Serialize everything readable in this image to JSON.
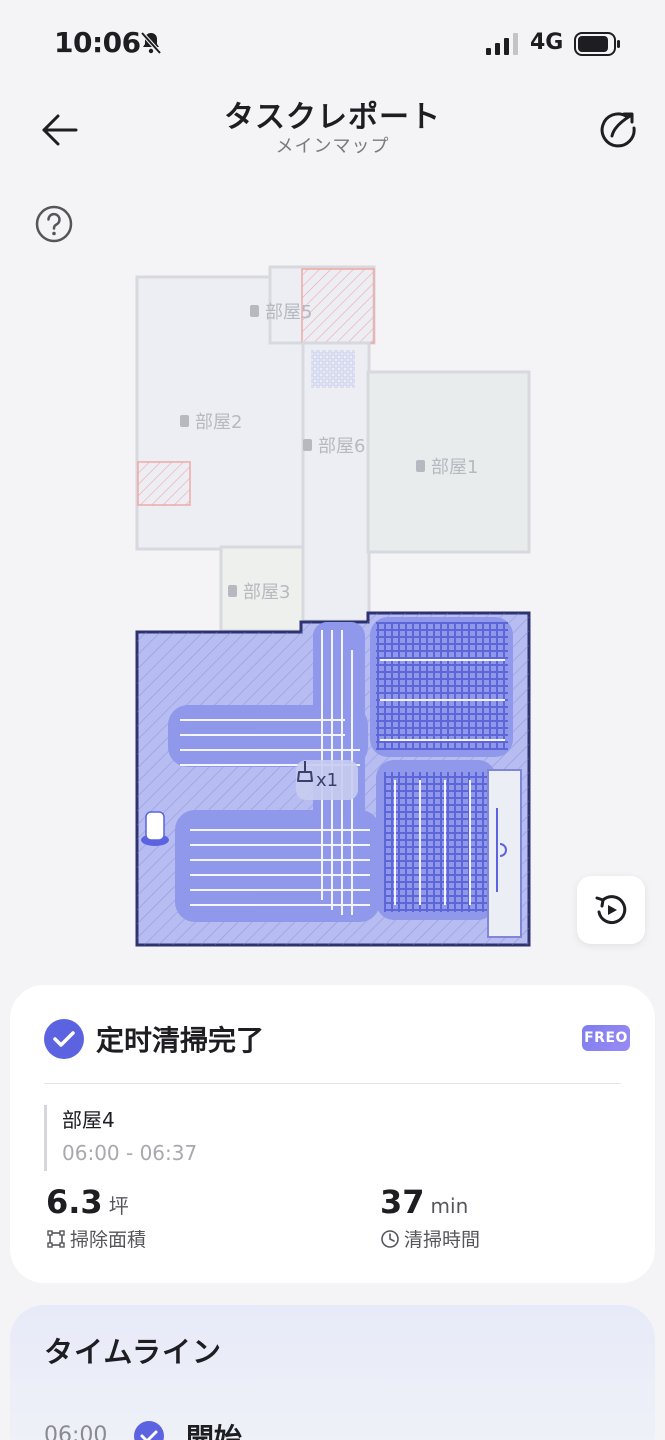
{
  "status_bar": {
    "time": "10:06",
    "network": "4G"
  },
  "header": {
    "title": "タスクレポート",
    "subtitle": "メインマップ"
  },
  "map": {
    "rooms": [
      {
        "label": "部屋5"
      },
      {
        "label": "部屋2"
      },
      {
        "label": "部屋6"
      },
      {
        "label": "部屋1"
      },
      {
        "label": "部屋3"
      }
    ],
    "clean_count": "x1"
  },
  "summary": {
    "title": "定时清掃完了",
    "mode_badge": "FREO",
    "room": "部屋4",
    "time_range": "06:00 - 06:37",
    "area_value": "6.3",
    "area_unit": "坪",
    "area_label": "掃除面積",
    "duration_value": "37",
    "duration_unit": "min",
    "duration_label": "清掃時間"
  },
  "timeline": {
    "title": "タイムライン",
    "events": [
      {
        "time": "06:00",
        "label": "開始"
      }
    ]
  },
  "colors": {
    "accent": "#5c63e0",
    "cleaned": "#9aa2ec",
    "room_fill": "#eceef3"
  }
}
